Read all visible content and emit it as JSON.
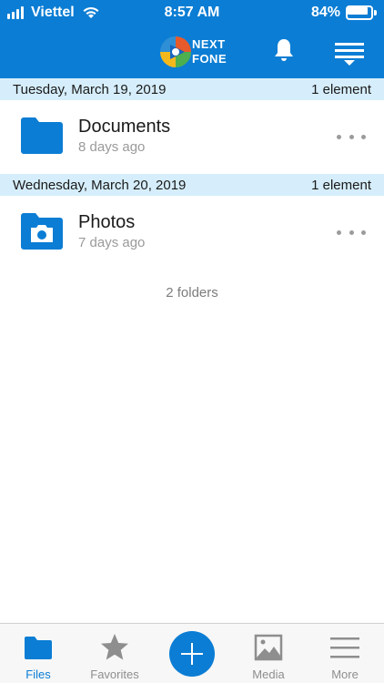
{
  "status_bar": {
    "carrier": "Viettel",
    "time": "8:57 AM",
    "battery": "84%",
    "battery_level": 0.84
  },
  "toolbar": {
    "logo_line1": "NEXT",
    "logo_line2": "FONE",
    "icons": [
      "notifications-bell-icon",
      "sort-menu-icon"
    ]
  },
  "sections": [
    {
      "date": "Tuesday, March 19, 2019",
      "count": "1 element",
      "item": {
        "name": "Documents",
        "modified": "8 days ago",
        "icon": "folder-icon"
      }
    },
    {
      "date": "Wednesday, March 20, 2019",
      "count": "1 element",
      "item": {
        "name": "Photos",
        "modified": "7 days ago",
        "icon": "camera-folder-icon"
      }
    }
  ],
  "summary": "2 folders",
  "tabbar": {
    "tabs": [
      {
        "label": "Files",
        "icon": "folder-icon",
        "active": true
      },
      {
        "label": "Favorites",
        "icon": "star-icon",
        "active": false
      },
      {
        "label": "",
        "icon": "plus-icon",
        "active": false
      },
      {
        "label": "Media",
        "icon": "image-icon",
        "active": false
      },
      {
        "label": "More",
        "icon": "hamburger-icon",
        "active": false
      }
    ]
  },
  "colors": {
    "accent": "#0b7dd4",
    "section_bg": "#d6eefb",
    "secondary_text": "#9a9a9a"
  }
}
